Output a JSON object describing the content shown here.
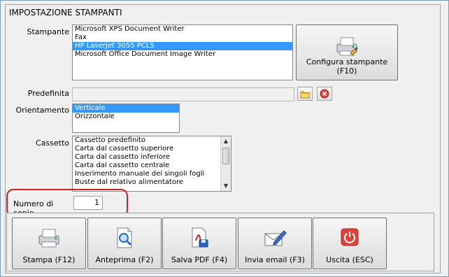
{
  "window": {
    "title": "IMPOSTAZIONE STAMPANTI"
  },
  "printer": {
    "label": "Stampante",
    "items": [
      {
        "text": "Microsoft XPS Document Writer",
        "selected": false
      },
      {
        "text": "Fax",
        "selected": false
      },
      {
        "text": "HP LaserJet 3055 PCL5",
        "selected": true
      },
      {
        "text": "Microsoft Office Document Image Writer",
        "selected": false
      }
    ],
    "configure_button": "Configura stampante (F10)"
  },
  "default": {
    "label": "Predefinita",
    "value": ""
  },
  "orientation": {
    "label": "Orientamento",
    "items": [
      {
        "text": "Verticale",
        "selected": true
      },
      {
        "text": "Orizzontale",
        "selected": false
      }
    ]
  },
  "tray": {
    "label": "Cassetto",
    "items": [
      "Cassetto predefinito",
      "Carta dal cassetto superiore",
      "Carta dal cassetto inferiore",
      "Carta dal cassetto centrale",
      "Inserimento manuale dei singoli fogli",
      "Buste dal relativo alimentatore"
    ]
  },
  "copies": {
    "label": "Numero di copie",
    "value": "1"
  },
  "actions": [
    {
      "name": "print",
      "label": "Stampa (F12)",
      "icon": "printer-icon"
    },
    {
      "name": "preview",
      "label": "Anteprima (F2)",
      "icon": "preview-icon"
    },
    {
      "name": "save-pdf",
      "label": "Salva PDF (F4)",
      "icon": "pdf-icon"
    },
    {
      "name": "send-email",
      "label": "Invia email (F3)",
      "icon": "email-icon"
    },
    {
      "name": "exit",
      "label": "Uscita (ESC)",
      "icon": "power-icon"
    }
  ],
  "colors": {
    "selection": "#3399ff",
    "highlight": "#d21f1f",
    "exit": "#e0433a"
  }
}
